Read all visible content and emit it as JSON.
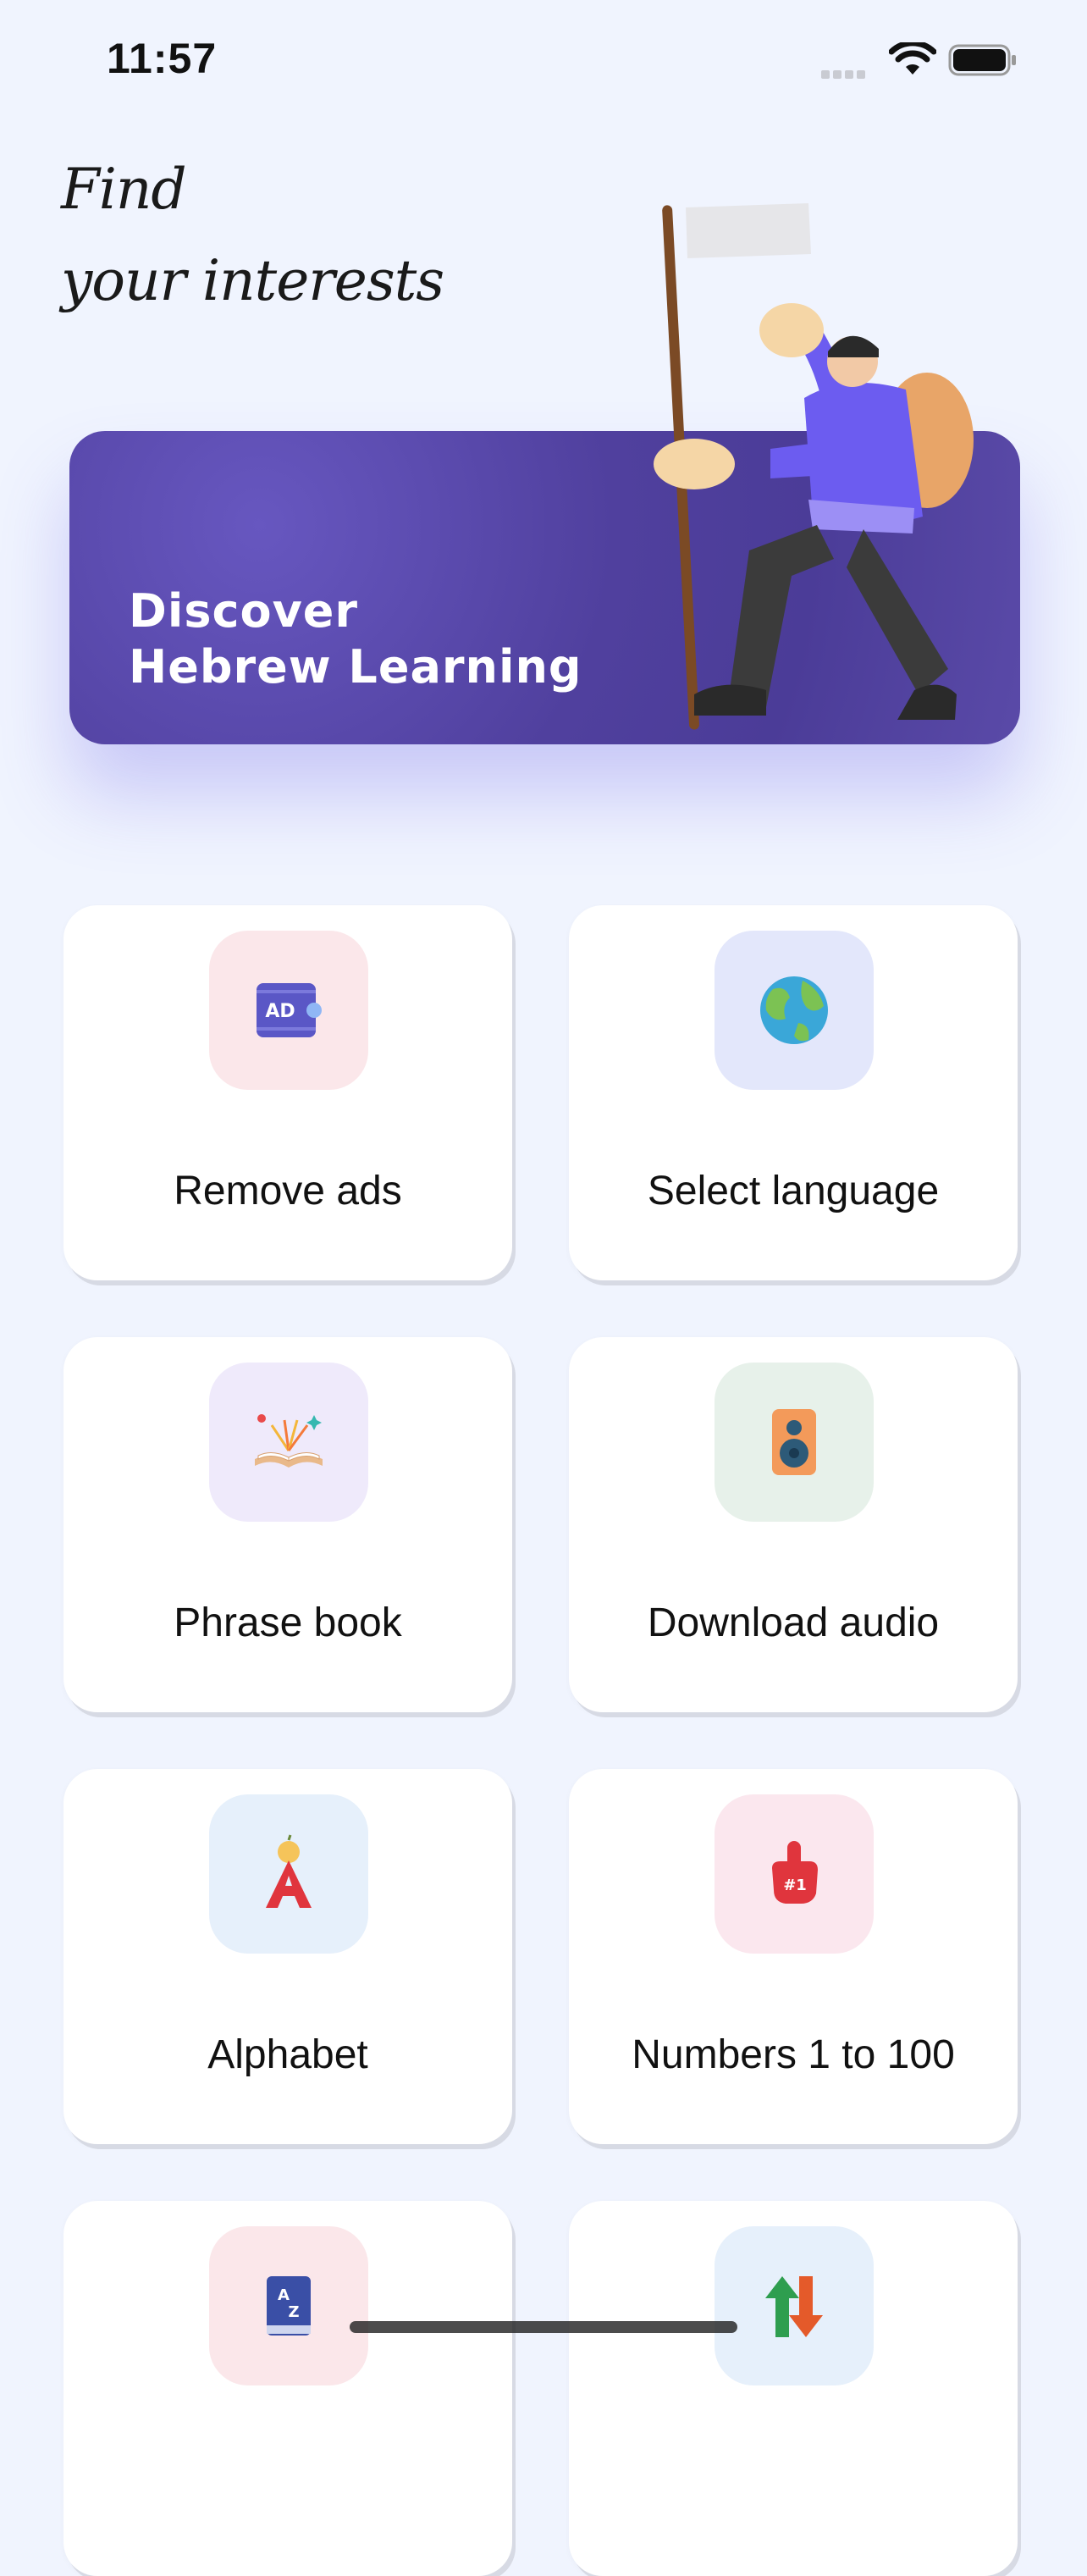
{
  "status_bar": {
    "time": "11:57"
  },
  "header": {
    "line1": "Find",
    "line2": "your interests"
  },
  "banner": {
    "line1": "Discover",
    "line2": "Hebrew Learning"
  },
  "cards": [
    {
      "label": "Remove ads",
      "icon": "ad-remove-icon",
      "tile_color": "#fbe7ea"
    },
    {
      "label": "Select language",
      "icon": "globe-icon",
      "tile_color": "#e3e7fb"
    },
    {
      "label": "Phrase book",
      "icon": "open-book-icon",
      "tile_color": "#efeafb"
    },
    {
      "label": "Download audio",
      "icon": "speaker-icon",
      "tile_color": "#e7f1ea"
    },
    {
      "label": "Alphabet",
      "icon": "letter-a-icon",
      "tile_color": "#e6f0fb"
    },
    {
      "label": "Numbers 1 to 100",
      "icon": "number-one-foam-finger-icon",
      "tile_color": "#fbe7ee"
    },
    {
      "label": "",
      "icon": "dictionary-az-icon",
      "tile_color": "#fbe7ea"
    },
    {
      "label": "",
      "icon": "sort-arrows-icon",
      "tile_color": "#e6f0fb"
    }
  ]
}
